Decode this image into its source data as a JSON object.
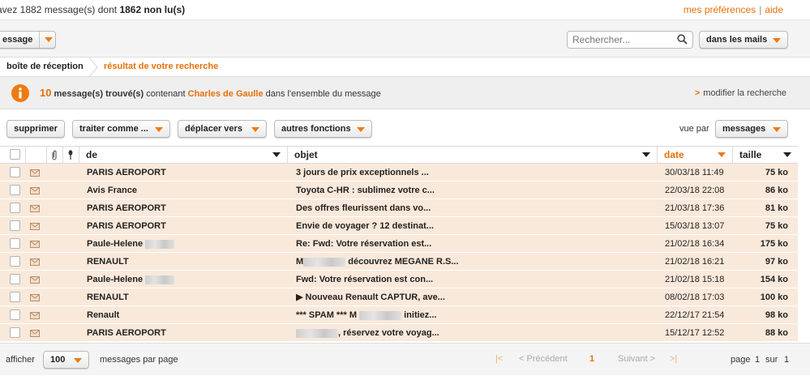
{
  "topbar": {
    "count_prefix": "avez 1882 message(s) dont",
    "unread": "1862 non lu(s)",
    "prefs_link": "mes préférences",
    "separator": "|",
    "help_link": "aide"
  },
  "toolbar1": {
    "message_button": "essage",
    "search_placeholder": "Rechercher...",
    "scope_button": "dans les mails"
  },
  "breadcrumb": {
    "inbox": "boîte de réception",
    "results": "résultat de votre recherche"
  },
  "info": {
    "count": "10",
    "found_label": "message(s) trouvé(s)",
    "containing": "contenant",
    "term": "Charles de Gaulle",
    "scope": "dans l'ensemble du message",
    "modify_arrow": ">",
    "modify_link": "modifier la recherche"
  },
  "actions": {
    "delete": "supprimer",
    "treat_as": "traiter comme ...",
    "move_to": "déplacer vers",
    "other": "autres fonctions",
    "view_by_label": "vue par",
    "view_by_value": "messages"
  },
  "table": {
    "headers": {
      "from": "de",
      "subject": "objet",
      "date": "date",
      "size": "taille"
    },
    "rows": [
      {
        "from": "PARIS AEROPORT",
        "subject": "3 jours de prix exceptionnels ...",
        "date": "30/03/18 11:49",
        "size": "75 ko"
      },
      {
        "from": "Avis France",
        "subject": "Toyota C-HR : sublimez votre c...",
        "date": "22/03/18 22:08",
        "size": "86 ko"
      },
      {
        "from": "PARIS AEROPORT",
        "subject": "Des offres fleurissent dans vo...",
        "date": "21/03/18 17:36",
        "size": "81 ko"
      },
      {
        "from": "PARIS AEROPORT",
        "subject": "Envie de voyager ? 12 destinat...",
        "date": "15/03/18 13:07",
        "size": "75 ko"
      },
      {
        "from": "Paule-Helene",
        "subject": "Re: Fwd: Votre réservation est...",
        "date": "21/02/18 16:34",
        "size": "175 ko"
      },
      {
        "from": "RENAULT",
        "subject_prefix": "M",
        "subject": "découvrez MEGANE R.S...",
        "date": "21/02/18 16:21",
        "size": "97 ko"
      },
      {
        "from": "Paule-Helene",
        "subject": "Fwd: Votre réservation est con...",
        "date": "21/02/18 15:18",
        "size": "154 ko"
      },
      {
        "from": "RENAULT",
        "subject": "▶  Nouveau Renault CAPTUR, ave...",
        "date": "08/02/18 17:03",
        "size": "100 ko"
      },
      {
        "from": "Renault",
        "subject_prefix": "*** SPAM *** M",
        "subject": "initiez...",
        "date": "22/12/17 21:54",
        "size": "98 ko"
      },
      {
        "from": "PARIS AEROPORT",
        "subject": ", réservez votre voyag...",
        "date": "15/12/17 12:52",
        "size": "88 ko"
      }
    ]
  },
  "footer": {
    "show_label": "afficher",
    "per_page_value": "100",
    "per_page_label": "messages par page",
    "first": "|<",
    "prev": "< Précédent",
    "current_page": "1",
    "next": "Suivant >",
    "last": ">|",
    "page_label": "page",
    "page_num": "1",
    "of_label": "sur",
    "total_pages": "1"
  },
  "colors": {
    "accent": "#e8700a",
    "row_bg": "#f9e9db"
  }
}
